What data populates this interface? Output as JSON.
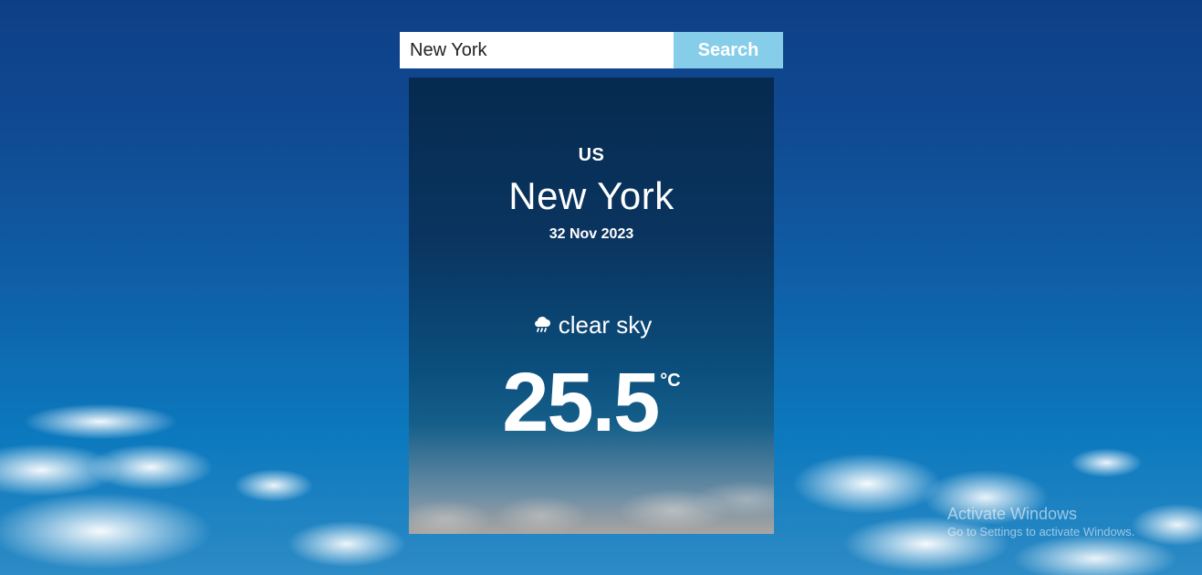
{
  "search": {
    "value": "New York",
    "button_label": "Search"
  },
  "weather": {
    "country": "US",
    "city": "New York",
    "date": "32 Nov 2023",
    "condition": "clear sky",
    "condition_icon": "rain-cloud-icon",
    "temperature": "25.5",
    "unit": "°C"
  },
  "watermark": {
    "title": "Activate Windows",
    "subtitle": "Go to Settings to activate Windows."
  },
  "colors": {
    "search_button": "#86cdea",
    "card_top": "#062a50",
    "card_mid": "#0b4d7c",
    "sky": "#104b93"
  }
}
